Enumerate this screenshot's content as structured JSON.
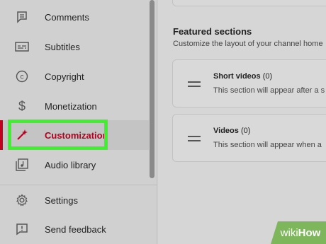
{
  "sidebar": {
    "items": [
      {
        "label": "Comments",
        "icon": "comment-icon"
      },
      {
        "label": "Subtitles",
        "icon": "subtitles-icon"
      },
      {
        "label": "Copyright",
        "icon": "copyright-icon"
      },
      {
        "label": "Monetization",
        "icon": "dollar-icon"
      },
      {
        "label": "Customization",
        "icon": "magic-wand-icon",
        "active": true
      },
      {
        "label": "Audio library",
        "icon": "music-library-icon"
      }
    ],
    "bottom_items": [
      {
        "label": "Settings",
        "icon": "gear-icon"
      },
      {
        "label": "Send feedback",
        "icon": "feedback-icon"
      }
    ]
  },
  "main": {
    "section_title": "Featured sections",
    "section_desc": "Customize the layout of your channel home",
    "cards": [
      {
        "title": "Short videos",
        "count": "(0)",
        "desc": "This section will appear after a s"
      },
      {
        "title": "Videos",
        "count": "(0)",
        "desc": "This section will appear when a"
      }
    ]
  },
  "watermark": {
    "wiki": "wiki",
    "how": "How"
  },
  "colors": {
    "accent": "#c4001f",
    "highlight": "#3cf22a",
    "watermark": "#7db65b"
  }
}
